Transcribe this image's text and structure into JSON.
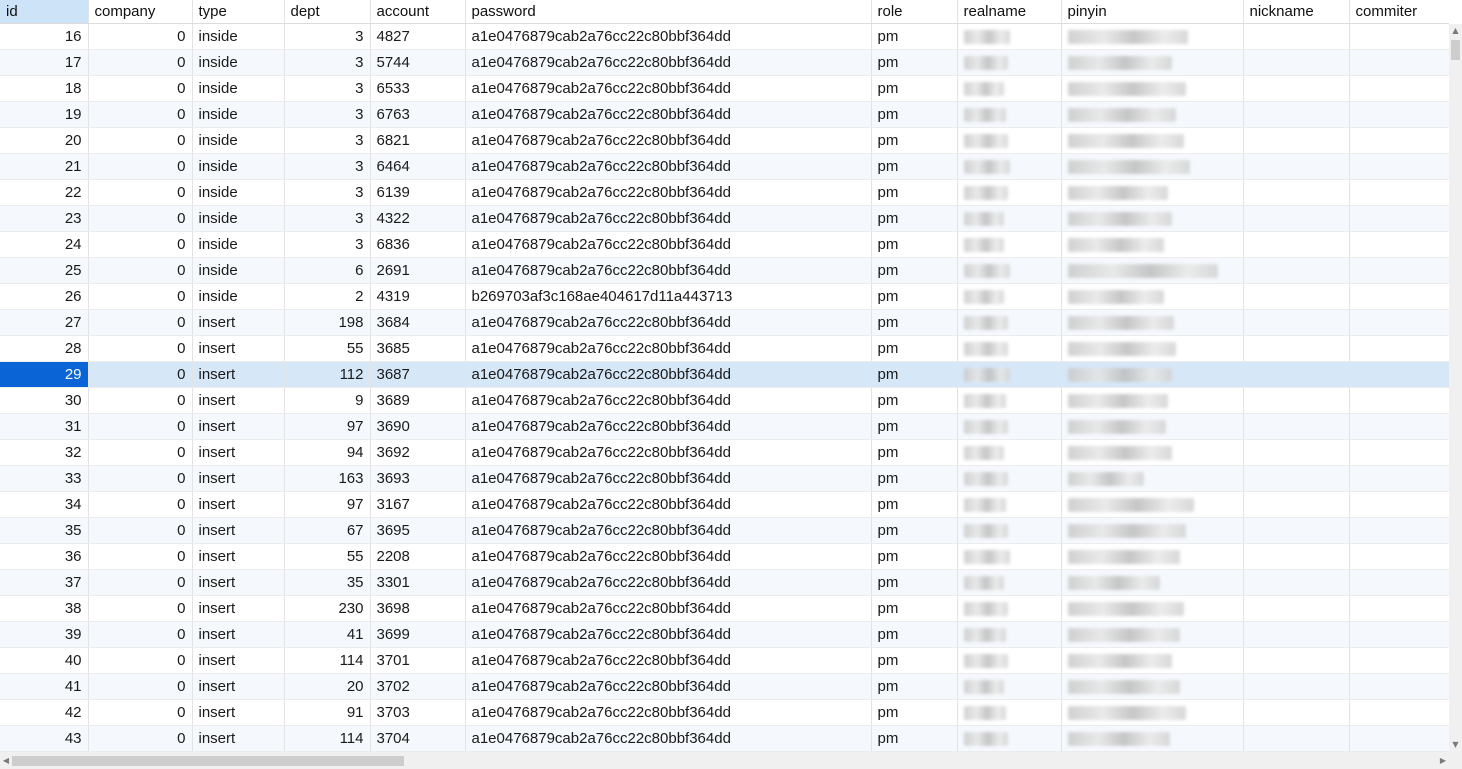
{
  "columns": [
    "id",
    "company",
    "type",
    "dept",
    "account",
    "password",
    "role",
    "realname",
    "pinyin",
    "nickname",
    "commiter"
  ],
  "selected_id": "29",
  "rows": [
    [
      "16",
      "0",
      "inside",
      "3",
      "4827",
      "a1e0476879cab2a76cc22c80bbf364dd",
      "pm"
    ],
    [
      "17",
      "0",
      "inside",
      "3",
      "5744",
      "a1e0476879cab2a76cc22c80bbf364dd",
      "pm"
    ],
    [
      "18",
      "0",
      "inside",
      "3",
      "6533",
      "a1e0476879cab2a76cc22c80bbf364dd",
      "pm"
    ],
    [
      "19",
      "0",
      "inside",
      "3",
      "6763",
      "a1e0476879cab2a76cc22c80bbf364dd",
      "pm"
    ],
    [
      "20",
      "0",
      "inside",
      "3",
      "6821",
      "a1e0476879cab2a76cc22c80bbf364dd",
      "pm"
    ],
    [
      "21",
      "0",
      "inside",
      "3",
      "6464",
      "a1e0476879cab2a76cc22c80bbf364dd",
      "pm"
    ],
    [
      "22",
      "0",
      "inside",
      "3",
      "6139",
      "a1e0476879cab2a76cc22c80bbf364dd",
      "pm"
    ],
    [
      "23",
      "0",
      "inside",
      "3",
      "4322",
      "a1e0476879cab2a76cc22c80bbf364dd",
      "pm"
    ],
    [
      "24",
      "0",
      "inside",
      "3",
      "6836",
      "a1e0476879cab2a76cc22c80bbf364dd",
      "pm"
    ],
    [
      "25",
      "0",
      "inside",
      "6",
      "2691",
      "a1e0476879cab2a76cc22c80bbf364dd",
      "pm"
    ],
    [
      "26",
      "0",
      "inside",
      "2",
      "4319",
      "b269703af3c168ae404617d11a443713",
      "pm"
    ],
    [
      "27",
      "0",
      "insert",
      "198",
      "3684",
      "a1e0476879cab2a76cc22c80bbf364dd",
      "pm"
    ],
    [
      "28",
      "0",
      "insert",
      "55",
      "3685",
      "a1e0476879cab2a76cc22c80bbf364dd",
      "pm"
    ],
    [
      "29",
      "0",
      "insert",
      "112",
      "3687",
      "a1e0476879cab2a76cc22c80bbf364dd",
      "pm"
    ],
    [
      "30",
      "0",
      "insert",
      "9",
      "3689",
      "a1e0476879cab2a76cc22c80bbf364dd",
      "pm"
    ],
    [
      "31",
      "0",
      "insert",
      "97",
      "3690",
      "a1e0476879cab2a76cc22c80bbf364dd",
      "pm"
    ],
    [
      "32",
      "0",
      "insert",
      "94",
      "3692",
      "a1e0476879cab2a76cc22c80bbf364dd",
      "pm"
    ],
    [
      "33",
      "0",
      "insert",
      "163",
      "3693",
      "a1e0476879cab2a76cc22c80bbf364dd",
      "pm"
    ],
    [
      "34",
      "0",
      "insert",
      "97",
      "3167",
      "a1e0476879cab2a76cc22c80bbf364dd",
      "pm"
    ],
    [
      "35",
      "0",
      "insert",
      "67",
      "3695",
      "a1e0476879cab2a76cc22c80bbf364dd",
      "pm"
    ],
    [
      "36",
      "0",
      "insert",
      "55",
      "2208",
      "a1e0476879cab2a76cc22c80bbf364dd",
      "pm"
    ],
    [
      "37",
      "0",
      "insert",
      "35",
      "3301",
      "a1e0476879cab2a76cc22c80bbf364dd",
      "pm"
    ],
    [
      "38",
      "0",
      "insert",
      "230",
      "3698",
      "a1e0476879cab2a76cc22c80bbf364dd",
      "pm"
    ],
    [
      "39",
      "0",
      "insert",
      "41",
      "3699",
      "a1e0476879cab2a76cc22c80bbf364dd",
      "pm"
    ],
    [
      "40",
      "0",
      "insert",
      "114",
      "3701",
      "a1e0476879cab2a76cc22c80bbf364dd",
      "pm"
    ],
    [
      "41",
      "0",
      "insert",
      "20",
      "3702",
      "a1e0476879cab2a76cc22c80bbf364dd",
      "pm"
    ],
    [
      "42",
      "0",
      "insert",
      "91",
      "3703",
      "a1e0476879cab2a76cc22c80bbf364dd",
      "pm"
    ],
    [
      "43",
      "0",
      "insert",
      "114",
      "3704",
      "a1e0476879cab2a76cc22c80bbf364dd",
      "pm"
    ]
  ],
  "colors": {
    "selection": "#0a64d6",
    "selected_row": "#d6e7f8",
    "alt_row": "#f5f9fd"
  }
}
